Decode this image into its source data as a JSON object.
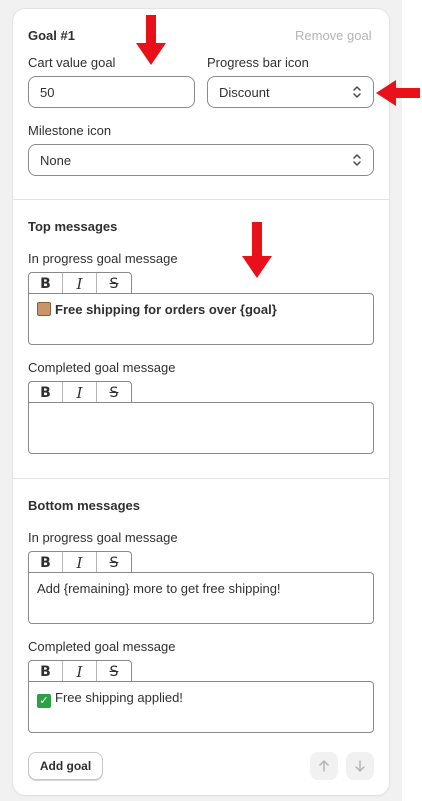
{
  "goal": {
    "title": "Goal #1",
    "remove_label": "Remove goal",
    "cart_value_label": "Cart value goal",
    "cart_value": "50",
    "progress_icon_label": "Progress bar icon",
    "progress_icon_value": "Discount",
    "milestone_icon_label": "Milestone icon",
    "milestone_icon_value": "None"
  },
  "toolbar": {
    "bold": "B",
    "italic": "I",
    "strike": "S"
  },
  "top_messages": {
    "heading": "Top messages",
    "in_progress_label": "In progress goal message",
    "in_progress_text": "Free shipping for orders over {goal}",
    "completed_label": "Completed goal message",
    "completed_text": ""
  },
  "bottom_messages": {
    "heading": "Bottom messages",
    "in_progress_label": "In progress goal message",
    "in_progress_text": "Add {remaining} more to get free shipping!",
    "completed_label": "Completed goal message",
    "completed_text": "Free shipping applied!"
  },
  "footer": {
    "add_goal_label": "Add goal"
  },
  "colors": {
    "annotation_arrow": "#e8111a",
    "text": "#303030",
    "muted": "#b5b5b5",
    "border": "#8a8a8a"
  }
}
